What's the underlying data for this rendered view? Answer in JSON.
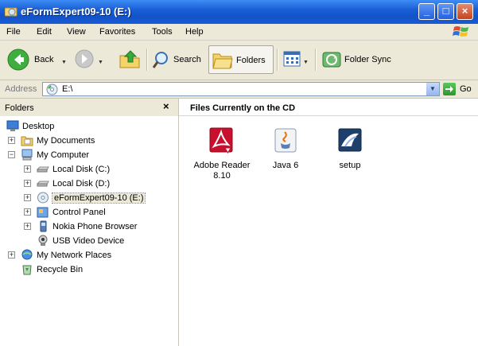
{
  "window": {
    "title": "eFormExpert09-10 (E:)"
  },
  "menu": [
    "File",
    "Edit",
    "View",
    "Favorites",
    "Tools",
    "Help"
  ],
  "toolbar": {
    "back": "Back",
    "search": "Search",
    "folders": "Folders",
    "folder_sync": "Folder Sync"
  },
  "address": {
    "label": "Address",
    "value": "E:\\",
    "go": "Go"
  },
  "folders_pane": {
    "title": "Folders",
    "close": "×",
    "items": [
      {
        "label": "Desktop",
        "icon": "desktop-icon"
      },
      {
        "label": "My Documents",
        "icon": "documents-folder-icon",
        "expander": "+"
      },
      {
        "label": "My Computer",
        "icon": "computer-icon",
        "expander": "−"
      },
      {
        "label": "Local Disk (C:)",
        "icon": "hard-disk-icon",
        "expander": "+"
      },
      {
        "label": "Local Disk (D:)",
        "icon": "hard-disk-icon",
        "expander": "+"
      },
      {
        "label": "eFormExpert09-10 (E:)",
        "icon": "cd-drive-icon",
        "expander": "+",
        "selected": true
      },
      {
        "label": "Control Panel",
        "icon": "control-panel-icon",
        "expander": "+"
      },
      {
        "label": "Nokia Phone Browser",
        "icon": "phone-icon",
        "expander": "+"
      },
      {
        "label": "USB Video Device",
        "icon": "webcam-icon"
      },
      {
        "label": "My Network Places",
        "icon": "network-icon",
        "expander": "+"
      },
      {
        "label": "Recycle Bin",
        "icon": "recycle-bin-icon"
      }
    ]
  },
  "content": {
    "heading": "Files Currently on the CD",
    "files": [
      {
        "label": "Adobe Reader 8.10",
        "icon": "adobe-reader-icon"
      },
      {
        "label": "Java 6",
        "icon": "java-icon"
      },
      {
        "label": "setup",
        "icon": "setup-icon"
      }
    ]
  },
  "colors": {
    "titlebar": "#1153c8",
    "chrome": "#ece9d8",
    "adobe": "#c8102e"
  }
}
